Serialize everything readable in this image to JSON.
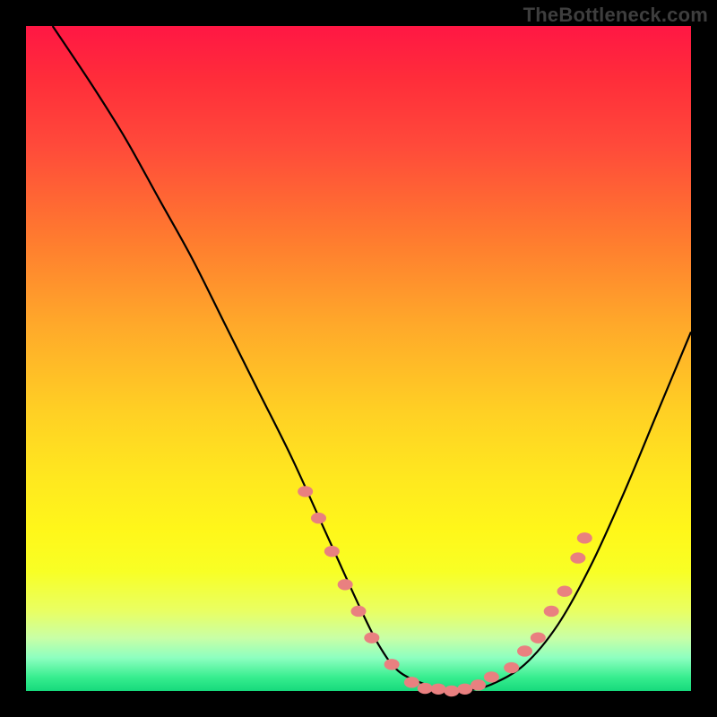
{
  "watermark": "TheBottleneck.com",
  "colors": {
    "background": "#000000",
    "gradient_top": "#ff1744",
    "gradient_bottom": "#16d97c",
    "curve_stroke": "#000000",
    "marker_fill": "#e98080"
  },
  "chart_data": {
    "type": "line",
    "title": "",
    "xlabel": "",
    "ylabel": "",
    "xlim": [
      0,
      100
    ],
    "ylim": [
      0,
      100
    ],
    "series": [
      {
        "name": "curve",
        "x": [
          4,
          10,
          15,
          20,
          25,
          30,
          35,
          40,
          45,
          50,
          53,
          56,
          60,
          63,
          66,
          70,
          75,
          80,
          85,
          90,
          95,
          100
        ],
        "y": [
          100,
          91,
          83,
          74,
          65,
          55,
          45,
          35,
          24,
          13,
          7,
          3,
          1,
          0,
          0,
          1,
          4,
          10,
          19,
          30,
          42,
          54
        ]
      }
    ],
    "markers": [
      {
        "x": 42,
        "y": 30
      },
      {
        "x": 44,
        "y": 26
      },
      {
        "x": 46,
        "y": 21
      },
      {
        "x": 48,
        "y": 16
      },
      {
        "x": 50,
        "y": 12
      },
      {
        "x": 52,
        "y": 8
      },
      {
        "x": 55,
        "y": 4
      },
      {
        "x": 58,
        "y": 1.3
      },
      {
        "x": 60,
        "y": 0.4
      },
      {
        "x": 62,
        "y": 0.3
      },
      {
        "x": 64,
        "y": 0.0
      },
      {
        "x": 66,
        "y": 0.3
      },
      {
        "x": 68,
        "y": 0.9
      },
      {
        "x": 70,
        "y": 2.1
      },
      {
        "x": 73,
        "y": 3.5
      },
      {
        "x": 75,
        "y": 6.0
      },
      {
        "x": 77,
        "y": 8
      },
      {
        "x": 79,
        "y": 12
      },
      {
        "x": 81,
        "y": 15
      },
      {
        "x": 83,
        "y": 20
      },
      {
        "x": 84,
        "y": 23
      }
    ]
  }
}
